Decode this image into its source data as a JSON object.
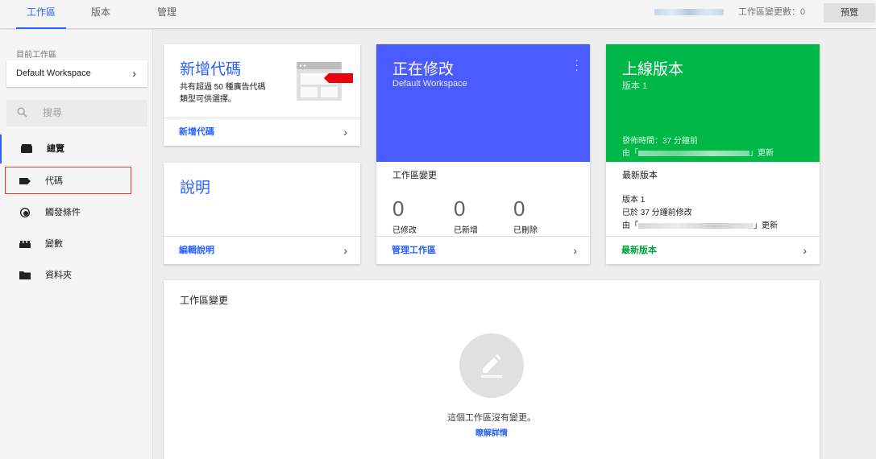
{
  "topbar": {
    "tabs": [
      {
        "label": "工作區",
        "active": true
      },
      {
        "label": "版本",
        "active": false
      },
      {
        "label": "管理",
        "active": false
      }
    ],
    "change_count": "工作區變更數：0",
    "preview_label": "預覽"
  },
  "sidebar": {
    "workspace_label": "目前工作區",
    "workspace_name": "Default Workspace",
    "search_placeholder": "搜尋",
    "items": [
      {
        "label": "總覽",
        "icon": "overview-icon"
      },
      {
        "label": "代碼",
        "icon": "tag-icon"
      },
      {
        "label": "觸發條件",
        "icon": "trigger-icon"
      },
      {
        "label": "變數",
        "icon": "variable-icon"
      },
      {
        "label": "資料夾",
        "icon": "folder-icon"
      }
    ]
  },
  "new_tag_card": {
    "title": "新增代碼",
    "desc_line1": "共有超過 50 種廣告代碼",
    "desc_line2": "類型可供選擇。",
    "footer": "新增代碼"
  },
  "description_card": {
    "title": "說明",
    "footer": "編輯說明"
  },
  "editing_card": {
    "title": "正在修改",
    "subtitle": "Default Workspace",
    "section_title": "工作區變更",
    "stats": [
      {
        "value": "0",
        "label": "已修改"
      },
      {
        "value": "0",
        "label": "已新增"
      },
      {
        "value": "0",
        "label": "已刪除"
      }
    ],
    "footer": "管理工作區"
  },
  "live_card": {
    "title": "上線版本",
    "subtitle": "版本 1",
    "published": "發佈時間：37 分鐘前",
    "by_prefix": "由「",
    "by_suffix": "」更新",
    "section_title": "最新版本",
    "version": "版本 1",
    "modified": "已於 37 分鐘前修改",
    "footer": "最新版本"
  },
  "changes_card": {
    "title": "工作區變更",
    "empty_text": "這個工作區沒有變更。",
    "learn_more": "瞭解詳情"
  },
  "colors": {
    "accent": "#2962ff",
    "editing_bg": "#4a5cff",
    "live_bg": "#00b848",
    "highlight": "#e53935"
  }
}
